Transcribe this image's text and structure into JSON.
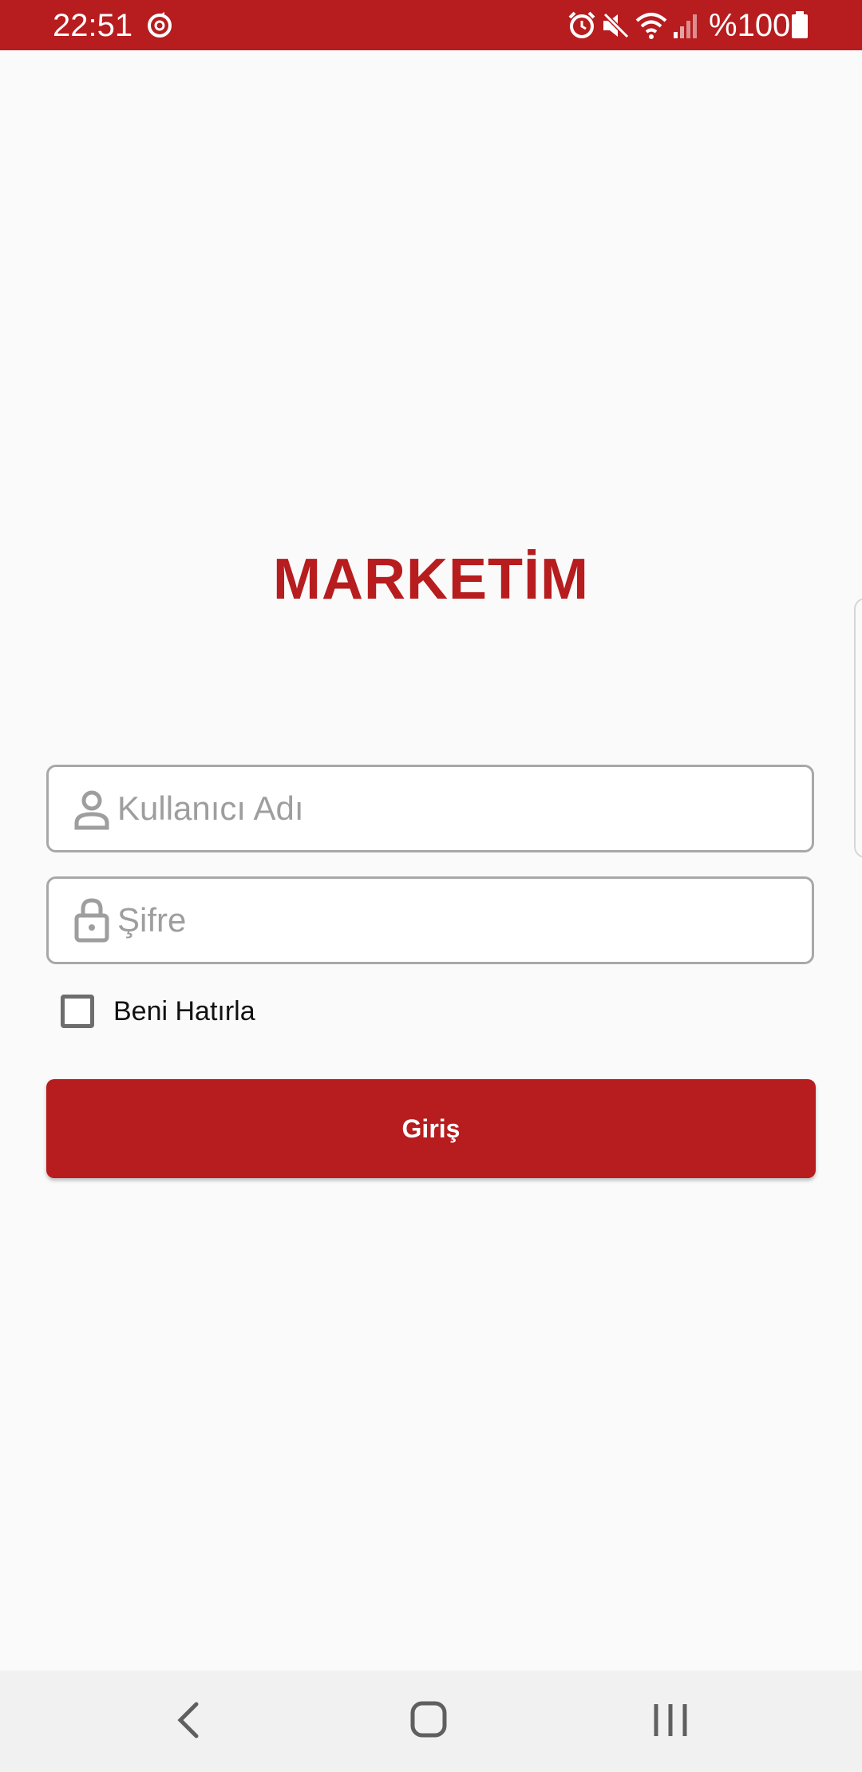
{
  "status_bar": {
    "time": "22:51",
    "battery_text": "%100",
    "icons": [
      "sync-icon",
      "alarm-icon",
      "mute-icon",
      "wifi-icon",
      "signal-icon",
      "battery-icon"
    ],
    "color": "#b71c1e"
  },
  "app": {
    "title": "MARKETİM",
    "accent_color": "#b71c1e"
  },
  "login_form": {
    "username_placeholder": "Kullanıcı Adı",
    "username_value": "",
    "password_placeholder": "Şifre",
    "password_value": "",
    "remember_label": "Beni Hatırla",
    "remember_checked": false,
    "login_button_label": "Giriş"
  },
  "nav_bar": {
    "buttons": [
      "back-icon",
      "home-icon",
      "recents-icon"
    ]
  }
}
